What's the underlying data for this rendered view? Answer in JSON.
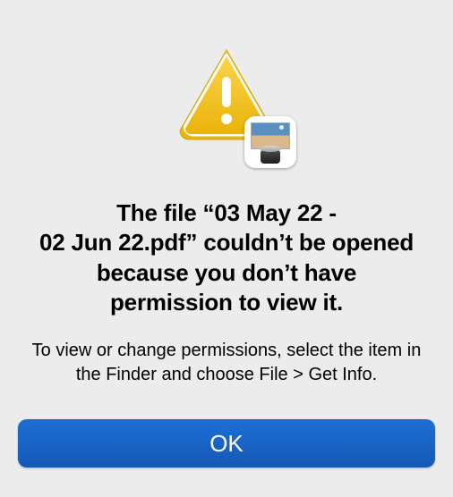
{
  "dialog": {
    "title": "The file “03 May 22 - 02 Jun 22.pdf” couldn’t be opened because you don’t have permission to view it.",
    "message": "To view or change permissions, select the item in the Finder and choose File > Get Info.",
    "ok_label": "OK"
  },
  "icons": {
    "warning": "warning-triangle-icon",
    "app": "preview-app-icon"
  },
  "colors": {
    "background": "#ececec",
    "button_top": "#1d6fd6",
    "button_bottom": "#1559b5",
    "warning_fill": "#f2c000",
    "warning_border": "#d1a000"
  }
}
